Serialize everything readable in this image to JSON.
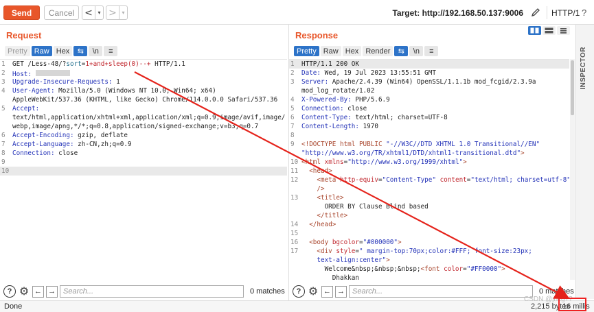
{
  "toolbar": {
    "send_label": "Send",
    "cancel_label": "Cancel",
    "back_arrow": "<",
    "back_drop": "▾",
    "fwd_arrow": ">",
    "fwd_drop": "▾",
    "target_label": "Target: http://192.168.50.137:9006",
    "http_version": "HTTP/1",
    "help": "?"
  },
  "request": {
    "title": "Request",
    "tabs": [
      "Pretty",
      "Raw",
      "Hex"
    ],
    "active_tab": "Raw",
    "icons": [
      "wrap-icon",
      "newline-icon",
      "menu-icon"
    ],
    "icon_glyphs": {
      "newline": "\\n",
      "menu": "≡",
      "wrap": "⇆"
    }
  },
  "response": {
    "title": "Response",
    "tabs": [
      "Pretty",
      "Raw",
      "Hex",
      "Render"
    ],
    "active_tab": "Pretty"
  },
  "inspector_label": "INSPECTOR",
  "search": {
    "placeholder": "Search...",
    "request_matches": "0 matches",
    "response_matches": "0 matches"
  },
  "status": {
    "left": "Done",
    "bytes": "2,215 bytes",
    "millis": "16 millis",
    "watermark": "CSDN @jhcg??"
  },
  "annotation": {
    "arrow_color": "#e5231b",
    "box_color": "#e5231b"
  }
}
